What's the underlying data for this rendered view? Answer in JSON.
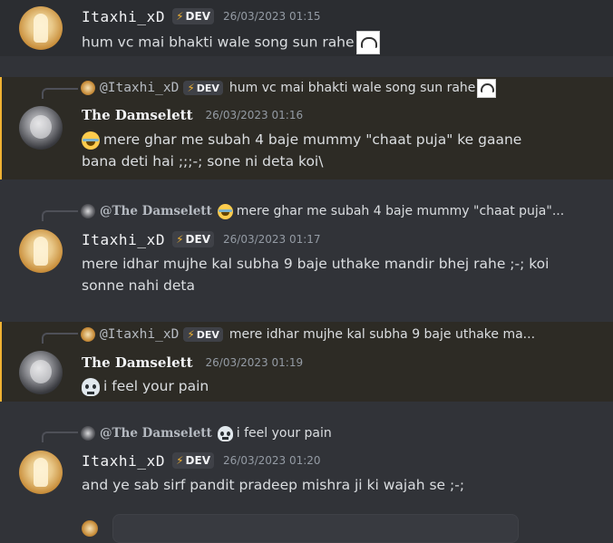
{
  "messages": [
    {
      "author": "Itaxhi_xD",
      "badge": "DEV",
      "timestamp": "26/03/2023 01:15",
      "text": "hum vc mai bhakti wale song sun rahe"
    },
    {
      "reply": {
        "author": "@Itaxhi_xD",
        "badge": "DEV",
        "text": "hum vc mai bhakti wale song sun rahe"
      },
      "author": "The Damselett",
      "timestamp": "26/03/2023 01:16",
      "text_line1": "mere ghar me subah 4 baje mummy \"chaat puja\" ke gaane",
      "text_line2": "bana deti hai ;;;-; sone ni deta koi\\"
    },
    {
      "reply": {
        "author": "@The Damselett",
        "text": "mere ghar me subah 4 baje mummy \"chaat puja\"..."
      },
      "author": "Itaxhi_xD",
      "badge": "DEV",
      "timestamp": "26/03/2023 01:17",
      "text_line1": "mere idhar mujhe kal subha 9 baje uthake mandir bhej rahe ;-; koi",
      "text_line2": "sonne nahi deta"
    },
    {
      "reply": {
        "author": "@Itaxhi_xD",
        "badge": "DEV",
        "text": "mere idhar mujhe kal subha 9 baje uthake ma..."
      },
      "author": "The Damselett",
      "timestamp": "26/03/2023 01:19",
      "text": "i feel your pain"
    },
    {
      "reply": {
        "author": "@The Damselett",
        "text": "i feel your pain"
      },
      "author": "Itaxhi_xD",
      "badge": "DEV",
      "timestamp": "26/03/2023 01:20",
      "text": "and ye sab sirf pandit pradeep mishra ji ki wajah se ;-;"
    }
  ],
  "icons": {
    "badge_icon": "lightning-bolt-icon",
    "sticker_emoji": "sticker-emoji-icon",
    "laugh_emoji": "face-with-tears-of-joy-icon",
    "skull_emoji": "skull-icon"
  },
  "colors": {
    "background": "#313338",
    "mention_bar": "#f0b232",
    "timestamp": "#949ba4"
  }
}
